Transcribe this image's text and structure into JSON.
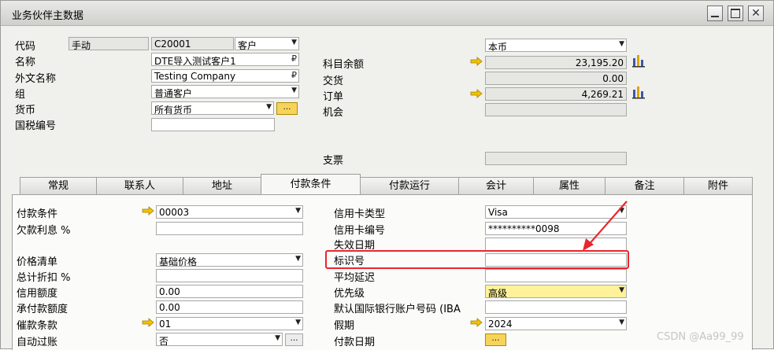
{
  "window": {
    "title": "业务伙伴主数据"
  },
  "header_left": {
    "code_label": "代码",
    "mode": "手动",
    "code_value": "C20001",
    "type_value": "客户",
    "name_label": "名称",
    "name_value": "DTE导入测试客户1",
    "foreign_name_label": "外文名称",
    "foreign_name_value": "Testing Company",
    "group_label": "组",
    "group_value": "普通客户",
    "currency_label": "货币",
    "currency_value": "所有货币",
    "tax_id_label": "国税编号",
    "tax_id_value": ""
  },
  "header_right": {
    "currency_select": "本币",
    "balance_label": "科目余额",
    "balance_value": "23,195.20",
    "deliveries_label": "交货",
    "deliveries_value": "0.00",
    "orders_label": "订单",
    "orders_value": "4,269.21",
    "opportunities_label": "机会",
    "opportunities_value": "",
    "checks_label": "支票",
    "checks_value": ""
  },
  "tabs": [
    {
      "label": "常规"
    },
    {
      "label": "联系人"
    },
    {
      "label": "地址"
    },
    {
      "label": "付款条件"
    },
    {
      "label": "付款运行"
    },
    {
      "label": "会计"
    },
    {
      "label": "属性"
    },
    {
      "label": "备注"
    },
    {
      "label": "附件"
    }
  ],
  "payment_left": {
    "terms_label": "付款条件",
    "terms_value": "00003",
    "interest_label": "欠款利息 %",
    "interest_value": "",
    "price_list_label": "价格清单",
    "price_list_value": "基础价格",
    "discount_label": "总计折扣 %",
    "discount_value": "",
    "credit_limit_label": "信用额度",
    "credit_limit_value": "0.00",
    "commitment_label": "承付款额度",
    "commitment_value": "0.00",
    "dunning_label": "催款条款",
    "dunning_value": "01",
    "auto_post_label": "自动过账",
    "auto_post_value": "否"
  },
  "payment_right": {
    "card_type_label": "信用卡类型",
    "card_type_value": "Visa",
    "card_no_label": "信用卡编号",
    "card_no_value": "**********0098",
    "expiry_label": "失效日期",
    "expiry_value": "",
    "id_no_label": "标识号",
    "id_no_value": "",
    "avg_delay_label": "平均延迟",
    "avg_delay_value": "",
    "priority_label": "优先级",
    "priority_value": "高级",
    "iban_label": "默认国际银行账户号码 (IBA",
    "iban_value": "",
    "holidays_label": "假期",
    "holidays_value": "2024",
    "pay_dates_label": "付款日期"
  },
  "annotation": {
    "color": "#e8262d"
  },
  "watermark": "CSDN @Aa99_99"
}
